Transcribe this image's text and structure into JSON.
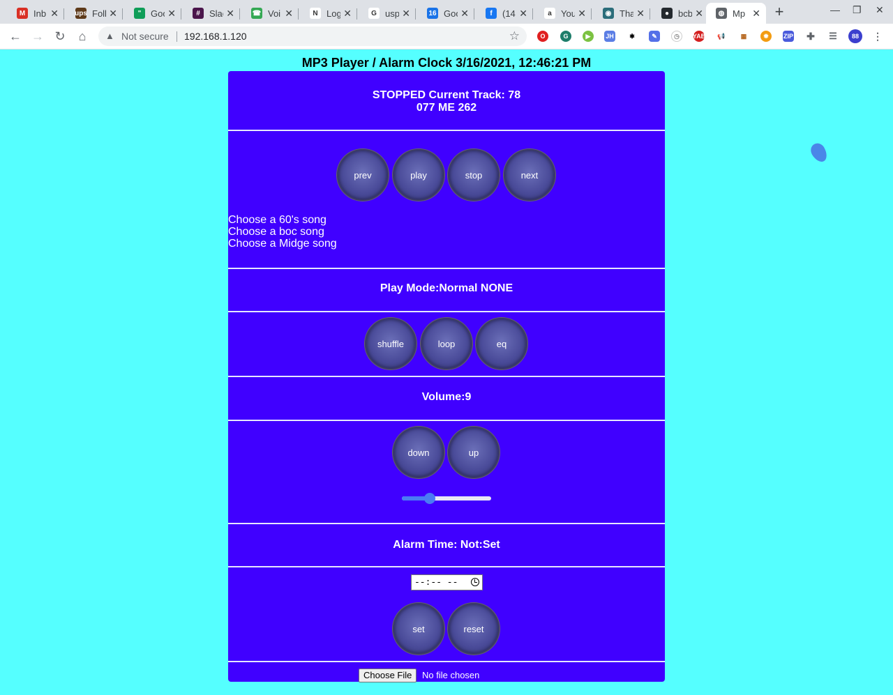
{
  "browser": {
    "tabs": [
      {
        "title": "Inb",
        "icon": "gmail-icon",
        "color": "#d93025",
        "glyph": "M"
      },
      {
        "title": "Foll",
        "icon": "ups-icon",
        "color": "#5e3a1a",
        "glyph": "ups"
      },
      {
        "title": "Goo",
        "icon": "hangouts-icon",
        "color": "#0f9d58",
        "glyph": "\""
      },
      {
        "title": "Slac",
        "icon": "slack-icon",
        "color": "#4a154b",
        "glyph": "#"
      },
      {
        "title": "Voi",
        "icon": "voice-icon",
        "color": "#34a853",
        "glyph": "☎"
      },
      {
        "title": "Log",
        "icon": "notion-icon",
        "color": "#ffffff",
        "glyph": "N"
      },
      {
        "title": "usp",
        "icon": "google-icon",
        "color": "#ffffff",
        "glyph": "G"
      },
      {
        "title": "Goo",
        "icon": "calendar-icon",
        "color": "#1a73e8",
        "glyph": "16"
      },
      {
        "title": "(14",
        "icon": "facebook-icon",
        "color": "#1877f2",
        "glyph": "f"
      },
      {
        "title": "You",
        "icon": "amazon-icon",
        "color": "#ffffff",
        "glyph": "a"
      },
      {
        "title": "Tha",
        "icon": "app-icon",
        "color": "#2b6d7a",
        "glyph": "◉"
      },
      {
        "title": "bcb",
        "icon": "github-icon",
        "color": "#24292e",
        "glyph": "●"
      },
      {
        "title": "Mp",
        "icon": "globe-icon",
        "color": "#5f6368",
        "glyph": "◍"
      }
    ],
    "url_warning": "Not secure",
    "url": "192.168.1.120"
  },
  "page": {
    "title": "MP3 Player / Alarm Clock 3/16/2021, 12:46:21 PM",
    "status_line1": "STOPPED Current Track: 78",
    "status_line2": "077 ME 262",
    "transport": {
      "prev": "prev",
      "play": "play",
      "stop": "stop",
      "next": "next"
    },
    "songs": [
      "Choose a 60's song",
      "Choose a boc song",
      "Choose a Midge song"
    ],
    "play_mode": "Play Mode:Normal NONE",
    "modes": {
      "shuffle": "shuffle",
      "loop": "loop",
      "eq": "eq"
    },
    "volume_label": "Volume:9",
    "volume_buttons": {
      "down": "down",
      "up": "up"
    },
    "volume_fraction": 0.31,
    "alarm_label": "Alarm Time: Not:Set",
    "alarm_input_placeholder": "--:-- --",
    "alarm_buttons": {
      "set": "set",
      "reset": "reset"
    },
    "file": {
      "button": "Choose File",
      "status": "No file chosen"
    }
  },
  "colors": {
    "page_bg": "#55ffff",
    "panel_bg": "#4000ff",
    "slider": "#4a7cf3"
  }
}
